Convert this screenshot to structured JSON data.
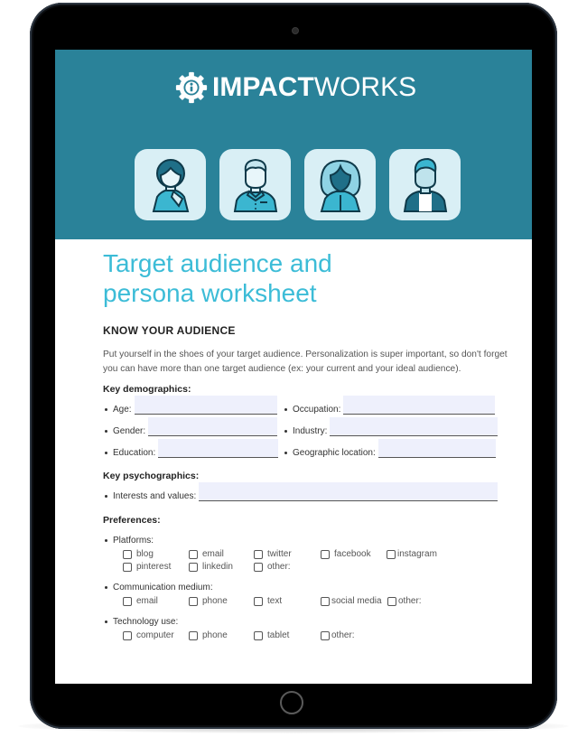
{
  "brand": {
    "logo_bold": "IMPACT",
    "logo_light": "WORKS",
    "header_color": "#2a8299",
    "title_color": "#3cbcd7"
  },
  "avatars": [
    {
      "name": "woman-short-hair"
    },
    {
      "name": "man-collared-shirt"
    },
    {
      "name": "woman-long-hair"
    },
    {
      "name": "man-jacket"
    }
  ],
  "worksheet": {
    "title_line1": "Target audience and",
    "title_line2": "persona worksheet",
    "section_heading": "KNOW YOUR AUDIENCE",
    "intro": "Put yourself in the shoes of your target audience. Personalization is super important, so don't forget you can have more than one target audience (ex: your current and your ideal audience).",
    "demographics": {
      "label": "Key demographics:",
      "fields": [
        {
          "label": "Age:",
          "value": ""
        },
        {
          "label": "Gender:",
          "value": ""
        },
        {
          "label": "Education:",
          "value": ""
        },
        {
          "label": "Occupation:",
          "value": ""
        },
        {
          "label": "Industry:",
          "value": ""
        },
        {
          "label": "Geographic location:",
          "value": ""
        }
      ]
    },
    "psychographics": {
      "label": "Key psychographics:",
      "fields": [
        {
          "label": "Interests and values:",
          "value": ""
        }
      ]
    },
    "preferences": {
      "label": "Preferences:",
      "groups": [
        {
          "label": "Platforms:",
          "options": [
            "blog",
            "email",
            "twitter",
            "facebook",
            "instagram",
            "pinterest",
            "linkedin",
            "other:"
          ]
        },
        {
          "label": "Communication medium:",
          "options": [
            "email",
            "phone",
            "text",
            "social media",
            "other:"
          ]
        },
        {
          "label": "Technology use:",
          "options": [
            "computer",
            "phone",
            "tablet",
            "other:"
          ]
        }
      ]
    }
  }
}
